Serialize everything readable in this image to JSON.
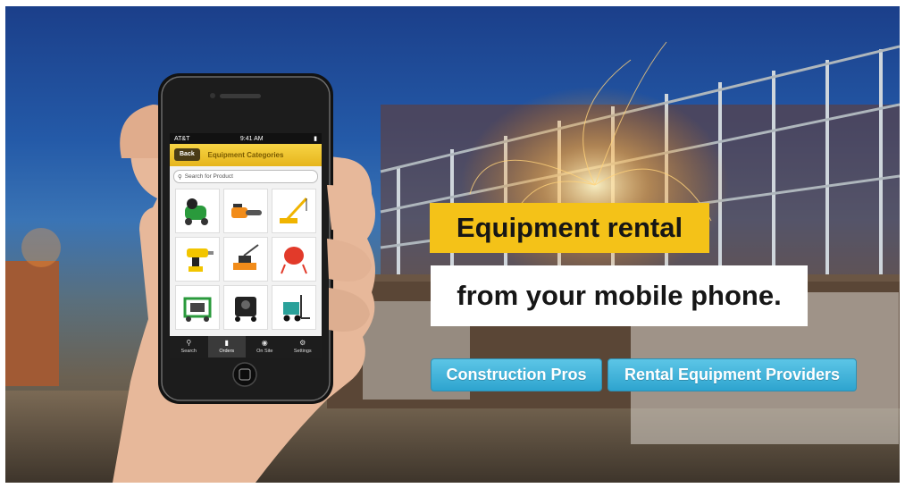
{
  "hero": {
    "headline_line1": "Equipment rental",
    "headline_line2": "from your mobile phone.",
    "cta_primary": "Construction Pros",
    "cta_secondary": "Rental Equipment Providers",
    "colors": {
      "highlight": "#f4c218",
      "button": "#3ab0d8",
      "sky": "#245aa8"
    }
  },
  "phone": {
    "carrier": "AT&T",
    "time": "9:41 AM",
    "back_label": "Back",
    "screen_title": "Equipment Categories",
    "search_placeholder": "Search for Product",
    "equipment_icons": [
      "air-compressor-icon",
      "chainsaw-icon",
      "crane-icon",
      "cordless-drill-icon",
      "plate-compactor-icon",
      "cement-mixer-icon",
      "generator-icon",
      "pressure-washer-icon",
      "forklift-icon"
    ],
    "tabs": [
      {
        "label": "Search",
        "icon": "search-icon",
        "active": false
      },
      {
        "label": "Orders",
        "icon": "clipboard-icon",
        "active": true
      },
      {
        "label": "On Site",
        "icon": "location-pin-icon",
        "active": false
      },
      {
        "label": "Settings",
        "icon": "gear-icon",
        "active": false
      }
    ]
  }
}
